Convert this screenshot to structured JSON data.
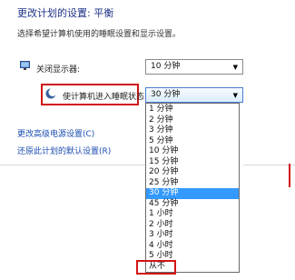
{
  "header": {
    "title": "更改计划的设置: 平衡",
    "subtitle": "选择希望计算机使用的睡眠设置和显示设置。"
  },
  "display_setting": {
    "icon": "monitor-icon",
    "label": "关闭显示器:",
    "value": "10 分钟"
  },
  "sleep_setting": {
    "icon": "moon-icon",
    "label": "使计算机进入睡眠状态:",
    "value": "30 分钟",
    "highlight_color": "#d21414"
  },
  "links": {
    "advanced": "更改高级电源设置(C)",
    "restore": "还原此计划的默认设置(R)"
  },
  "dropdown": {
    "options": [
      "1 分钟",
      "2 分钟",
      "3 分钟",
      "5 分钟",
      "10 分钟",
      "15 分钟",
      "20 分钟",
      "25 分钟",
      "30 分钟",
      "45 分钟",
      "1 小时",
      "2 小时",
      "3 小时",
      "4 小时",
      "5 小时",
      "从不"
    ],
    "selected": "30 分钟",
    "selection_color": "#3399ff"
  }
}
